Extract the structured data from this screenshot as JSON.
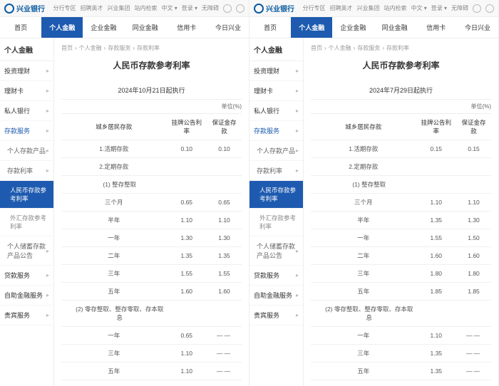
{
  "brand": "兴业银行",
  "topbar": {
    "links": [
      "分行专区",
      "招聘英才",
      "兴业集团",
      "站内检索",
      "中文 ▾",
      "登录 ▾",
      "无障碍"
    ]
  },
  "nav": {
    "items": [
      "首页",
      "个人金融",
      "企业金融",
      "同业金融",
      "信用卡",
      "今日兴业"
    ],
    "activeIndex": 1
  },
  "sidebar": {
    "title": "个人金融",
    "items": [
      {
        "label": "投资理财",
        "lv": 1,
        "chev": true
      },
      {
        "label": "理财卡",
        "lv": 1,
        "chev": true
      },
      {
        "label": "私人银行",
        "lv": 1,
        "chev": true
      },
      {
        "label": "存款服务",
        "lv": 1,
        "chev": true,
        "blue": true
      },
      {
        "label": "个人存款产品",
        "lv": 2,
        "chev": true
      },
      {
        "label": "存款利率",
        "lv": 2,
        "chev": true
      },
      {
        "label": "人民币存款参考利率",
        "lv": 3,
        "active": true
      },
      {
        "label": "外汇存款参考利率",
        "lv": 3
      },
      {
        "label": "个人储蓄存款产品公告",
        "lv": 2,
        "chev": true
      },
      {
        "label": "贷款服务",
        "lv": 1,
        "chev": true
      },
      {
        "label": "自助金融服务",
        "lv": 1,
        "chev": true
      },
      {
        "label": "贵宾服务",
        "lv": 1,
        "chev": true
      }
    ]
  },
  "breadcrumb": [
    "首页",
    "个人金融",
    "存款服务",
    "存款利率"
  ],
  "left": {
    "title": "人民币存款参考利率",
    "date": "2024年10月21日起执行",
    "unit": "单位(%)",
    "headers": [
      "城乡居民存款",
      "挂牌公告利率",
      "保证金存款"
    ],
    "chart_data": {
      "type": "table",
      "title": "人民币存款参考利率 2024年10月21日起执行",
      "columns": [
        "项目",
        "挂牌公告利率",
        "保证金存款"
      ],
      "rows": [
        {
          "label": "1.活期存款",
          "c1": "0.10",
          "c2": "0.10",
          "sect": false
        },
        {
          "label": "2.定期存款",
          "c1": "",
          "c2": "",
          "sect": false
        },
        {
          "label": "(1) 整存整取",
          "c1": "",
          "c2": "",
          "sect": true
        },
        {
          "label": "三个月",
          "c1": "0.65",
          "c2": "0.65",
          "sect": false
        },
        {
          "label": "半年",
          "c1": "1.10",
          "c2": "1.10",
          "sect": false
        },
        {
          "label": "一年",
          "c1": "1.30",
          "c2": "1.30",
          "sect": false
        },
        {
          "label": "二年",
          "c1": "1.35",
          "c2": "1.35",
          "sect": false
        },
        {
          "label": "三年",
          "c1": "1.55",
          "c2": "1.55",
          "sect": false
        },
        {
          "label": "五年",
          "c1": "1.60",
          "c2": "1.60",
          "sect": false
        },
        {
          "label": "(2) 零存整取、整存零取、存本取息",
          "c1": "",
          "c2": "",
          "sect": true
        },
        {
          "label": "一年",
          "c1": "0.65",
          "c2": "——",
          "sect": false
        },
        {
          "label": "三年",
          "c1": "1.10",
          "c2": "——",
          "sect": false
        },
        {
          "label": "五年",
          "c1": "1.10",
          "c2": "——",
          "sect": false
        }
      ]
    }
  },
  "right": {
    "title": "人民币存款参考利率",
    "date": "2024年7月29日起执行",
    "unit": "单位(%)",
    "headers": [
      "城乡居民存款",
      "挂牌公告利率",
      "保证金存款"
    ],
    "chart_data": {
      "type": "table",
      "title": "人民币存款参考利率 2024年7月29日起执行",
      "columns": [
        "项目",
        "挂牌公告利率",
        "保证金存款"
      ],
      "rows": [
        {
          "label": "1.活期存款",
          "c1": "0.15",
          "c2": "0.15",
          "sect": false
        },
        {
          "label": "2.定期存款",
          "c1": "",
          "c2": "",
          "sect": false
        },
        {
          "label": "(1) 整存整取",
          "c1": "",
          "c2": "",
          "sect": true
        },
        {
          "label": "三个月",
          "c1": "1.10",
          "c2": "1.10",
          "sect": false
        },
        {
          "label": "半年",
          "c1": "1.35",
          "c2": "1.30",
          "sect": false
        },
        {
          "label": "一年",
          "c1": "1.55",
          "c2": "1.50",
          "sect": false
        },
        {
          "label": "二年",
          "c1": "1.60",
          "c2": "1.60",
          "sect": false
        },
        {
          "label": "三年",
          "c1": "1.80",
          "c2": "1.80",
          "sect": false
        },
        {
          "label": "五年",
          "c1": "1.85",
          "c2": "1.85",
          "sect": false
        },
        {
          "label": "(2) 零存整取、整存零取、存本取息",
          "c1": "",
          "c2": "",
          "sect": true
        },
        {
          "label": "一年",
          "c1": "1.10",
          "c2": "——",
          "sect": false
        },
        {
          "label": "三年",
          "c1": "1.35",
          "c2": "——",
          "sect": false
        },
        {
          "label": "五年",
          "c1": "1.35",
          "c2": "——",
          "sect": false
        }
      ]
    }
  }
}
